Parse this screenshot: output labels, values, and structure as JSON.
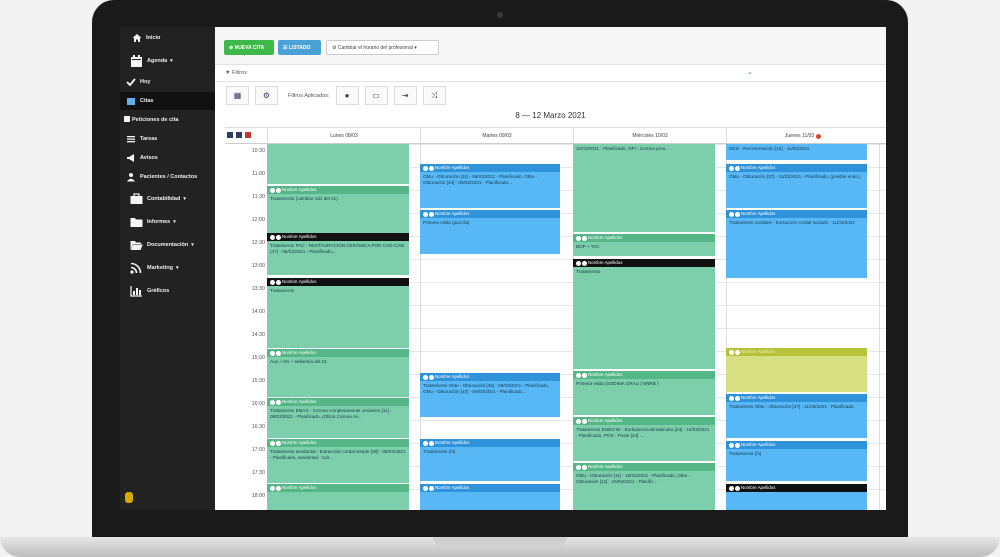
{
  "sidebar": {
    "items": [
      {
        "label": "Inicio",
        "icon": "home-icon"
      },
      {
        "label": "Agenda",
        "icon": "calendar-icon",
        "caret": "▾"
      },
      {
        "label": "Hoy",
        "icon": "check-icon"
      },
      {
        "label": "Citas",
        "icon": "calendar-small-icon"
      },
      {
        "label": "Peticiones de cita",
        "icon": "inbox-icon"
      },
      {
        "label": "Tareas",
        "icon": "list-icon"
      },
      {
        "label": "Avisos",
        "icon": "megaphone-icon"
      },
      {
        "label": "Pacientes / Contactos",
        "icon": "user-icon"
      },
      {
        "label": "Contabilidad",
        "icon": "briefcase-icon",
        "caret": "▾"
      },
      {
        "label": "Informes",
        "icon": "folder-icon",
        "caret": "▾"
      },
      {
        "label": "Documentación",
        "icon": "folder-open-icon",
        "caret": "▾"
      },
      {
        "label": "Marketing",
        "icon": "rss-icon",
        "caret": "▾"
      },
      {
        "label": "Gráficos",
        "icon": "bar-chart-icon"
      }
    ]
  },
  "toolbar": {
    "new_appointment": "⊕ NUEVA CITA",
    "list": "☰ LISTADO",
    "change_schedule": "⚙ Cambiar el horario del profesional ▾"
  },
  "filters": {
    "label": "▼ Filtros",
    "applied_label": "Filtros Aplicados:"
  },
  "calendar": {
    "range_title": "8 — 12 Marzo 2021",
    "days": [
      "Lunes 08/03",
      "Martes 09/03",
      "Miércoles 10/03",
      "Jueves 11/03"
    ],
    "times": [
      "10:30",
      "11:00",
      "11:30",
      "12:00",
      "12:30",
      "13:00",
      "13:30",
      "14:00",
      "14:30",
      "15:00",
      "15:30",
      "16:00",
      "16:30",
      "17:00",
      "17:30",
      "18:00"
    ],
    "events": [
      {
        "head": "Nombre Apellidos",
        "text": "Tratamiento (cambiar raíz del 21)"
      },
      {
        "head": "Nombre Apellidos",
        "text": "Tratamiento PAC - RESTAURACIÓN CERÁMICA POR CAD-CAM (47) - 08/03/2021 - Planificado..."
      },
      {
        "head": "Nombre Apellidos",
        "text": "Tratamiento"
      },
      {
        "head": "Nombre Apellidos",
        "text": "Aux. / rev + sellarlo/a del 21"
      },
      {
        "head": "Nombre Apellidos",
        "text": "Tratamiento EMAX - Corona completamente cerámica [11] - 08/03/2021 - Planificado, (Oficio Corona ce..."
      },
      {
        "head": "Nombre Apellidos",
        "text": "Tratamiento exodontal - Extracción cordal simple [38] - 08/03/2021 - Planificado, exodontal - Cdr..."
      },
      {
        "head": "Nombre Apellidos",
        "text": ""
      },
      {
        "head": "Nombre Apellidos",
        "text": "Obtu - Obturación [11] - 09/03/2021 - Planificado, Obtu - Obturación [43] - 09/03/2021 - Planificado..."
      },
      {
        "head": "Nombre Apellidos",
        "text": "Primera visita (paci lla)"
      },
      {
        "head": "Nombre Apellidos",
        "text": "Tratamiento Obtu - Obturación [46] - 09/03/2021 - Planificado, Obtu - Obturación [47] - 09/03/2021 - Planificado..."
      },
      {
        "head": "Nombre Apellidos",
        "text": "Tratamiento (hi)"
      },
      {
        "head": "Nombre Apellidos",
        "text": ""
      },
      {
        "head": "",
        "text": "10/03/2021 - Planificado, OFI - Corona prov..."
      },
      {
        "head": "Nombre Apellidos",
        "text": "BOP + TAC"
      },
      {
        "head": "Nombre Apellidos",
        "text": "Tratamiento"
      },
      {
        "head": "Nombre Apellidos",
        "text": "Primera visita (SODIMA GRAU | NNRB )"
      },
      {
        "head": "Nombre Apellidos",
        "text": "Tratamiento ENDO BI - Endodoncia Birradicular [24] - 10/03/2021 - Planificado, POS - Poste [24] -..."
      },
      {
        "head": "Nombre Apellidos",
        "text": "Obtu - Obturación [11] - 10/03/2021 - Planificado, Obtu - Obturación [12] - 10/03/2021 - Planific..."
      },
      {
        "head": "",
        "text": "MCE - Recimentación [15] - 11/03/2021"
      },
      {
        "head": "Nombre Apellidos",
        "text": "Obtu - Obturación [37] - 11/03/2021 - Planificado, (posible endo.)"
      },
      {
        "head": "Nombre Apellidos",
        "text": "Tratamiento cordales - Extracción cordal incluido - 11/03/2021"
      },
      {
        "head": "Nombre Apellidos",
        "text": ""
      },
      {
        "head": "Nombre Apellidos",
        "text": "Tratamiento Obtu - Obturación [37] - 11/03/2021 - Planificado."
      },
      {
        "head": "Nombre Apellidos",
        "text": "Tratamiento (hi)"
      },
      {
        "head": "Nombre Apellidos",
        "text": ""
      }
    ]
  },
  "colors": {
    "sidebar_bg": "#222222",
    "green_button": "#3fb84a",
    "blue_button": "#4aa1d6",
    "event_green": "#7dcfab",
    "event_blue": "#57b8f5",
    "event_olive": "#d6df82",
    "event_header_black": "#111111"
  }
}
